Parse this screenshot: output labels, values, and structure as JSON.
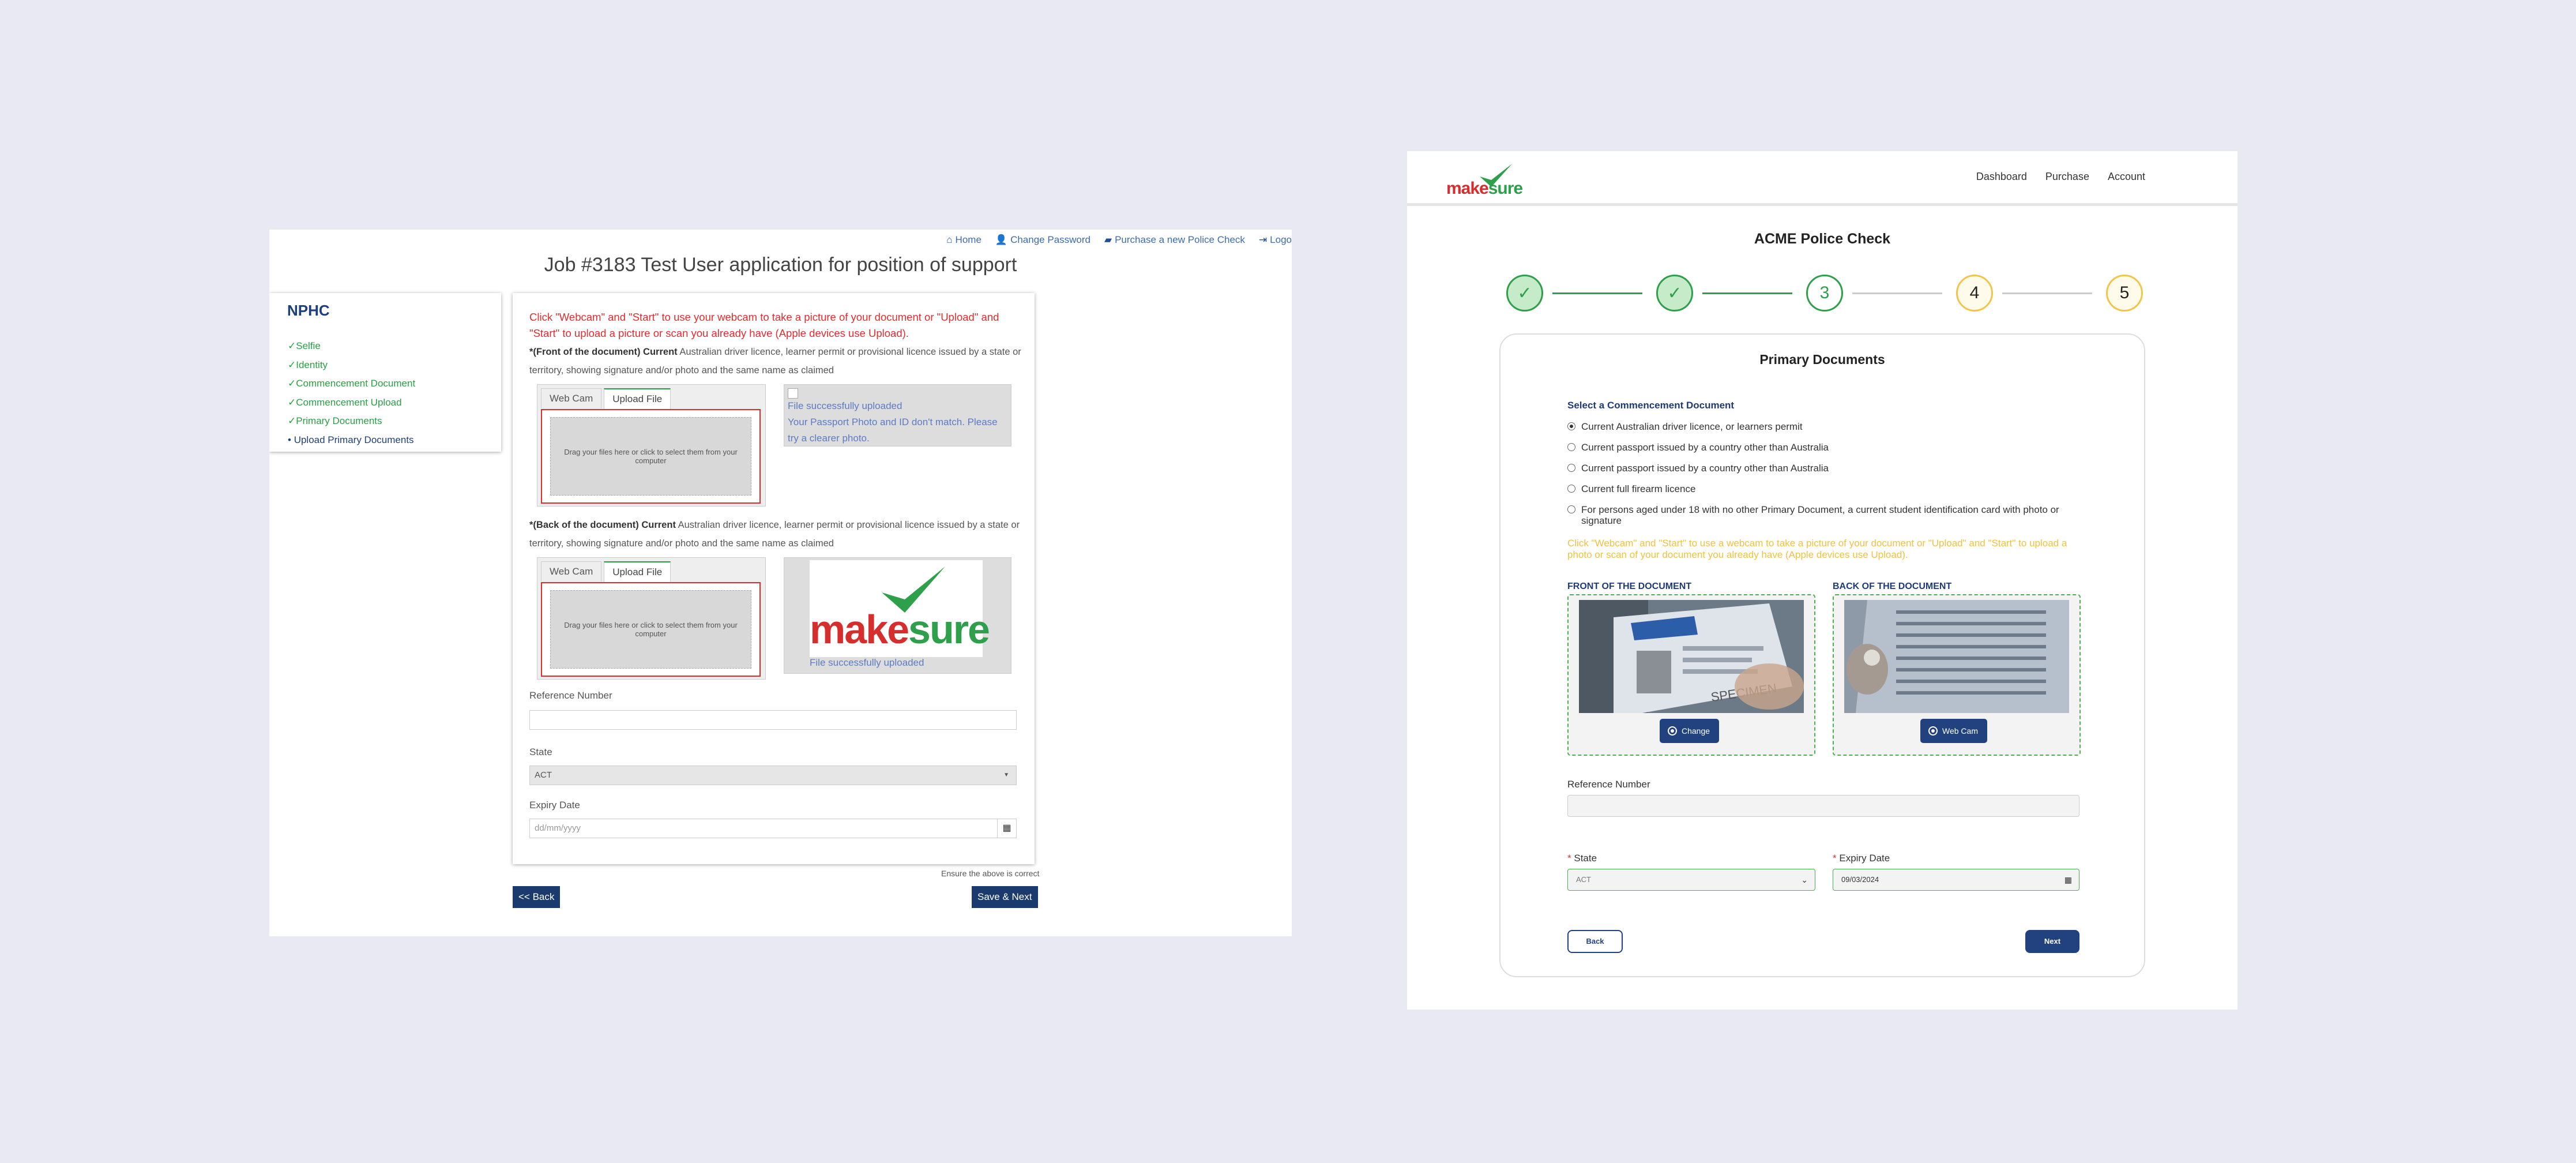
{
  "old_ui": {
    "nav": {
      "home": "Home",
      "change_password": "Change Password",
      "purchase": "Purchase a new Police Check",
      "logout": "Logo"
    },
    "job_title": "Job #3183 Test User application for position of support",
    "sidebar": {
      "title": "NPHC",
      "items": [
        {
          "label": "Selfie",
          "mark": "✓"
        },
        {
          "label": "Identity",
          "mark": "✓"
        },
        {
          "label": "Commencement Document",
          "mark": "✓"
        },
        {
          "label": "Commencement Upload",
          "mark": "✓"
        },
        {
          "label": "Primary Documents",
          "mark": "✓"
        },
        {
          "label": "Upload Primary Documents",
          "mark": "•"
        }
      ]
    },
    "warning": "Click \"Webcam\" and \"Start\" to use your webcam to take a picture of your document or \"Upload\" and \"Start\" to upload a picture or scan you already have (Apple devices use Upload).",
    "front": {
      "desc_bold": "*(Front of the document) Current",
      "desc_rest": "Australian driver licence, learner permit or provisional licence issued by a state or territory, showing signature and/or photo and the same name as claimed",
      "tab_webcam": "Web Cam",
      "tab_upload": "Upload File",
      "drop_text": "Drag your files here or click to select them from your computer",
      "status": "File successfully uploaded",
      "error": "Your Passport Photo and ID don't match. Please try a clearer photo."
    },
    "back": {
      "desc_bold": "*(Back of the document) Current",
      "desc_rest": "Australian driver licence, learner permit or provisional licence issued by a state or territory, showing signature and/or photo and the same name as claimed",
      "tab_webcam": "Web Cam",
      "tab_upload": "Upload File",
      "drop_text": "Drag your files here or click to select them from your computer",
      "logo_make": "make",
      "logo_sure": "sure",
      "status": "File successfully uploaded"
    },
    "reference_label": "Reference Number",
    "state_label": "State",
    "state_value": "ACT",
    "expiry_label": "Expiry Date",
    "expiry_placeholder": "dd/mm/yyyy",
    "ensure": "Ensure the above is correct",
    "back_btn": "<< Back",
    "save_btn": "Save & Next"
  },
  "new_ui": {
    "logo_make": "make",
    "logo_sure": "sure",
    "menu": [
      "Dashboard",
      "Purchase",
      "Account"
    ],
    "page_title": "ACME Police Check",
    "steps": [
      {
        "label": "✓",
        "state": "done"
      },
      {
        "label": "✓",
        "state": "done"
      },
      {
        "label": "3",
        "state": "current"
      },
      {
        "label": "4",
        "state": "todo"
      },
      {
        "label": "5",
        "state": "todo"
      }
    ],
    "card_title": "Primary Documents",
    "select_label": "Select a Commencement Document",
    "options": [
      {
        "label": "Current Australian driver licence, or learners permit",
        "selected": true
      },
      {
        "label": "Current passport issued by a country other than Australia",
        "selected": false
      },
      {
        "label": "Current passport issued by a country other than Australia",
        "selected": false
      },
      {
        "label": "Current full firearm licence",
        "selected": false
      },
      {
        "label": "For persons aged under 18 with no other Primary Document, a current student identification card with photo or signature",
        "selected": false
      }
    ],
    "hint": "Click \"Webcam\" and \"Start\" to use a webcam to take a picture of your document or \"Upload\" and \"Start\" to upload a photo or scan of your document you already have (Apple devices use Upload).",
    "front_label": "FRONT OF THE DOCUMENT",
    "back_label": "BACK OF THE DOCUMENT",
    "front_button": "Change",
    "back_button": "Web Cam",
    "specimen_text": "SPECIMEN",
    "reference_label": "Reference Number",
    "state_required": "*",
    "state_label": "State",
    "state_value": "ACT",
    "expiry_required": "*",
    "expiry_label": "Expiry Date",
    "expiry_value": "09/03/2024",
    "back_btn": "Back",
    "next_btn": "Next"
  },
  "colors": {
    "background": "#e8e9f3",
    "accent_green": "#2e9f4b",
    "accent_navy": "#21427f",
    "warn_red": "#e22c2c",
    "hint_yellow": "#f0c040"
  }
}
